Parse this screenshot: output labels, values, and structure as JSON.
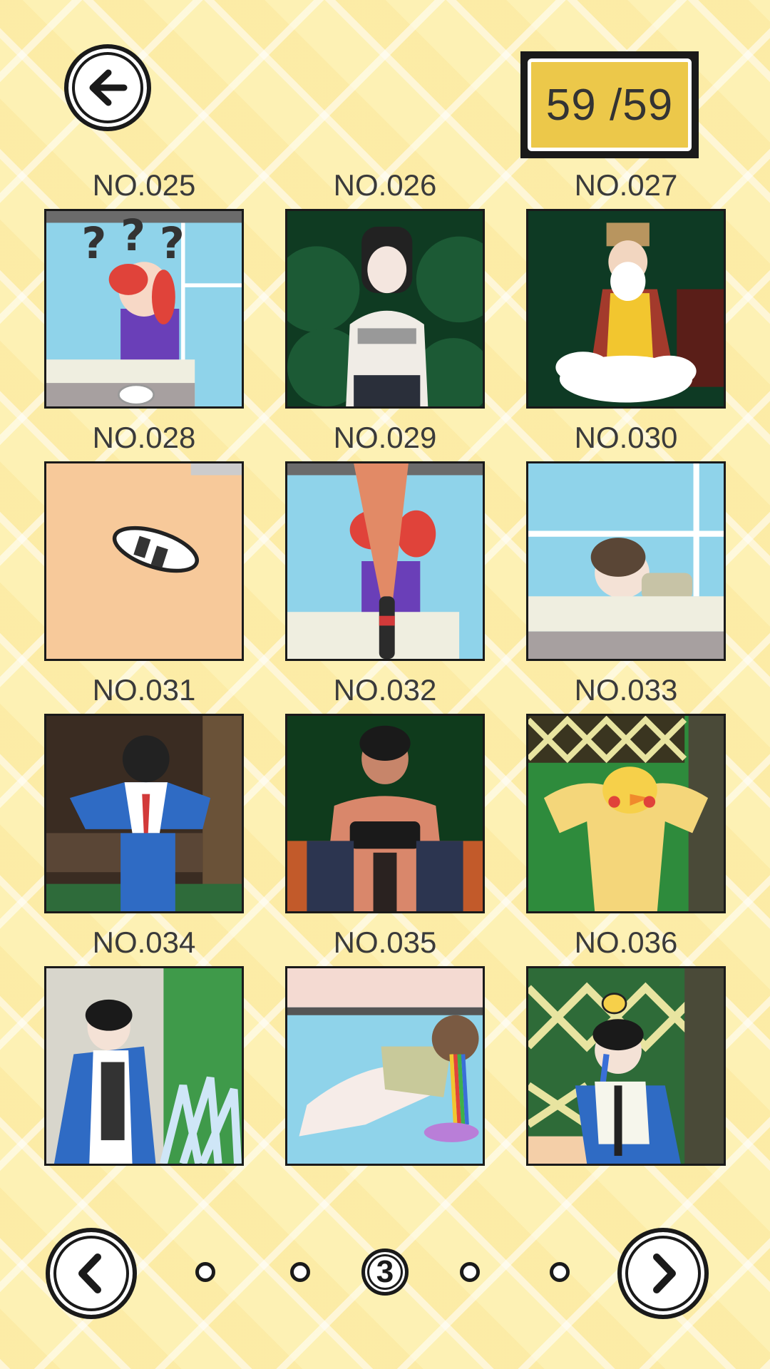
{
  "header": {
    "back_icon": "arrow-left-icon",
    "counter_text": "59 /59"
  },
  "gallery": {
    "items": [
      {
        "label": "NO.025",
        "scene": "girl-confused-question-marks"
      },
      {
        "label": "NO.026",
        "scene": "schoolgirl-arms-crossed"
      },
      {
        "label": "NO.027",
        "scene": "old-sage-on-cloud"
      },
      {
        "label": "NO.028",
        "scene": "shoe-on-floor"
      },
      {
        "label": "NO.029",
        "scene": "girl-soda-fountain"
      },
      {
        "label": "NO.030",
        "scene": "boy-sleeping-on-desk"
      },
      {
        "label": "NO.031",
        "scene": "boy-nosebleed-on-bench"
      },
      {
        "label": "NO.032",
        "scene": "boy-playing-phone"
      },
      {
        "label": "NO.033",
        "scene": "muscular-chick"
      },
      {
        "label": "NO.034",
        "scene": "boy-water-splash"
      },
      {
        "label": "NO.035",
        "scene": "girl-rainbow-vomit"
      },
      {
        "label": "NO.036",
        "scene": "boy-crying-with-bee"
      }
    ]
  },
  "pagination": {
    "prev_icon": "chevron-left-icon",
    "next_icon": "chevron-right-icon",
    "current_page": "3",
    "total_pages": 5
  },
  "colors": {
    "background": "#fdf1b4",
    "counter_fill": "#ecc84a",
    "outline": "#1a1a1a"
  }
}
